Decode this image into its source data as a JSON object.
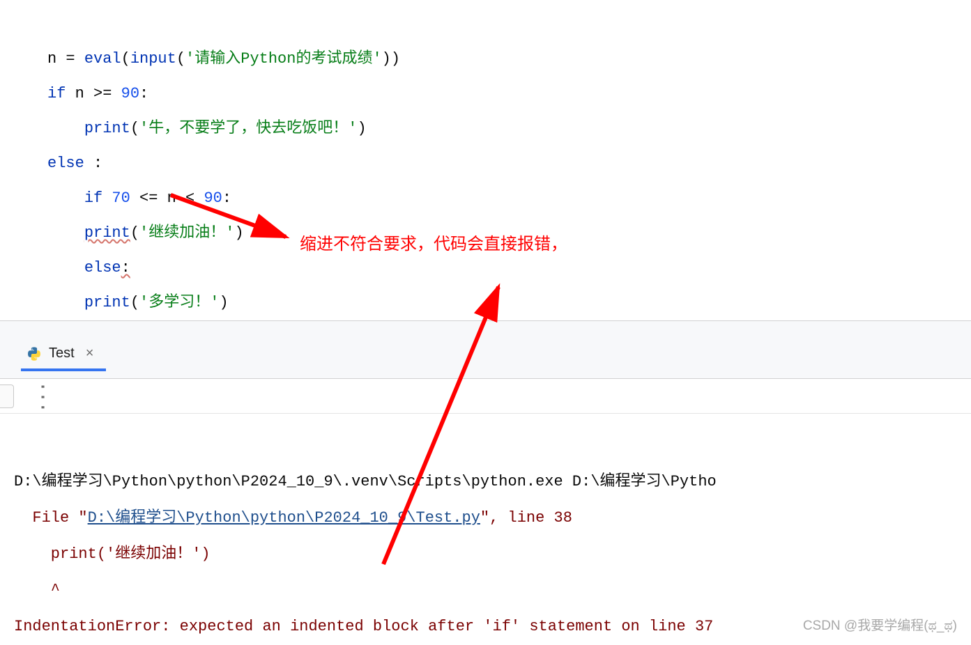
{
  "code": {
    "line1": {
      "var": "n = ",
      "eval": "eval",
      "paren_o": "(",
      "input": "input",
      "paren2_o": "(",
      "str": "'请输入Python的考试成绩'",
      "close": "))"
    },
    "line2": {
      "if": "if",
      "rest": " n >= ",
      "num": "90",
      "colon": ":"
    },
    "line3": {
      "indent": "    ",
      "print": "print",
      "paren_o": "(",
      "str": "'牛，不要学了，快去吃饭吧！'",
      "close": ")"
    },
    "line4": {
      "else": "else",
      "space": " ",
      "colon": ":"
    },
    "line5": {
      "indent": "    ",
      "if": "if",
      "sp1": " ",
      "n1": "70",
      "op1": " <= n < ",
      "n2": "90",
      "colon": ":"
    },
    "line6": {
      "indent": "    ",
      "print": "print",
      "paren_o": "(",
      "str": "'继续加油！'",
      "close": ")"
    },
    "line7": {
      "indent": "    ",
      "else": "else",
      "colon": ":"
    },
    "line8": {
      "indent": "    ",
      "print": "print",
      "paren_o": "(",
      "str": "'多学习！'",
      "close": ")"
    }
  },
  "annotation": "缩进不符合要求，代码会直接报错，",
  "tab": {
    "name": "Test",
    "close": "×"
  },
  "console": {
    "run_path": "D:\\编程学习\\Python\\python\\P2024_10_9\\.venv\\Scripts\\python.exe D:\\编程学习\\Pytho",
    "file_label": "  File \"",
    "file_link": "D:\\编程学习\\Python\\python\\P2024_10_9\\Test.py",
    "file_suffix": "\", line 38",
    "err_code": "    print('继续加油！')",
    "caret": "    ^",
    "error": "IndentationError: expected an indented block after 'if' statement on line 37"
  },
  "watermark": "CSDN @我要学编程(ಥ_ಥ)"
}
